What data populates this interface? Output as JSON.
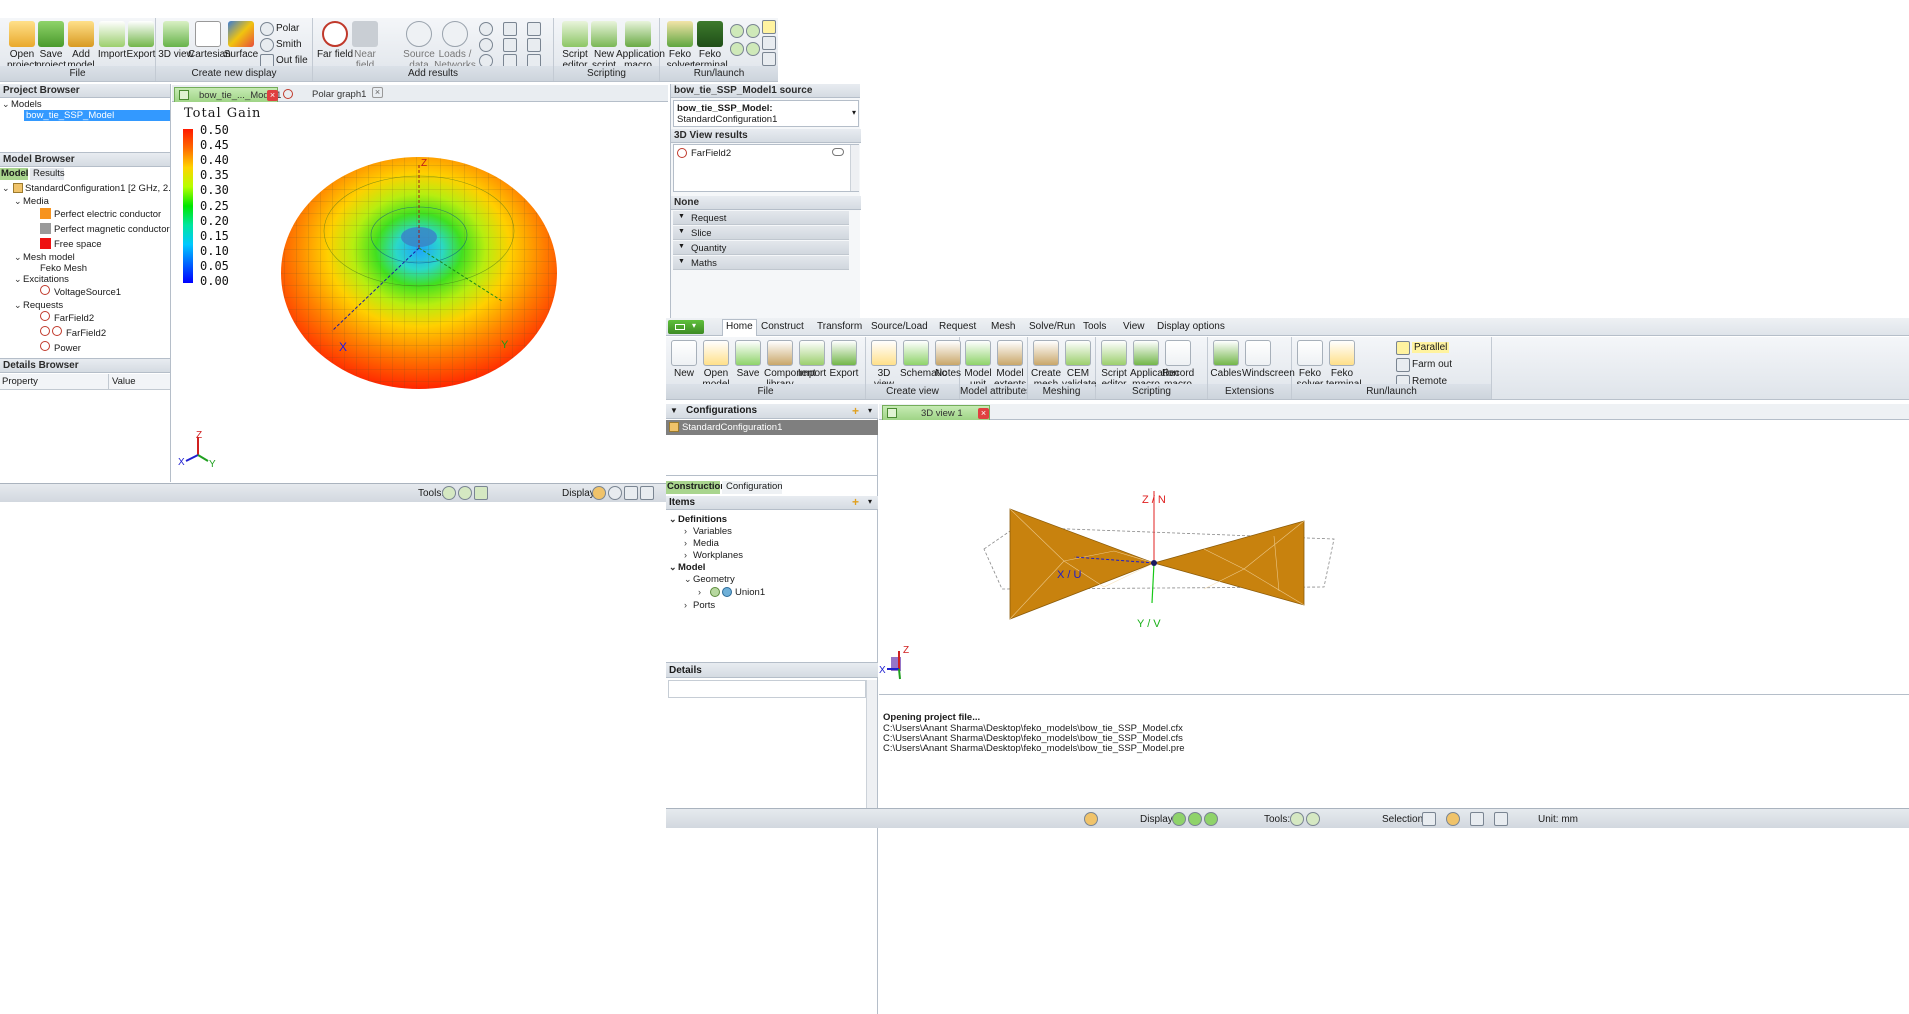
{
  "postfeko": {
    "ribbon": {
      "groups": [
        {
          "label": "File",
          "buttons": [
            "Open project",
            "Save project",
            "Add model",
            "Import",
            "Export"
          ]
        },
        {
          "label": "Create new display",
          "buttons": [
            "3D view",
            "Cartesian",
            "Surface"
          ],
          "small": [
            "Polar",
            "Smith",
            "Out file"
          ]
        },
        {
          "label": "Add results",
          "buttons": [
            "Far field",
            "Near field",
            "Source data",
            "Loads / Networks"
          ]
        },
        {
          "label": "Scripting",
          "buttons": [
            "Script editor",
            "New script",
            "Application macro"
          ]
        },
        {
          "label": "Run/launch",
          "buttons": [
            "Feko solver",
            "Feko terminal"
          ]
        }
      ]
    },
    "project_browser": {
      "title": "Project Browser",
      "models_label": "Models",
      "selected_model": "bow_tie_SSP_Model"
    },
    "model_browser": {
      "title": "Model Browser",
      "tabs": [
        "Model",
        "Results"
      ],
      "config": "StandardConfiguration1 [2 GHz, 2.0101 ...",
      "media_label": "Media",
      "media": [
        {
          "name": "Perfect electric conductor",
          "color": "#f7931e"
        },
        {
          "name": "Perfect magnetic conductor",
          "color": "#9a9a9a"
        },
        {
          "name": "Free space",
          "color": "#ee1111"
        }
      ],
      "mesh_model_label": "Mesh model",
      "mesh_item": "Feko Mesh",
      "excitations_label": "Excitations",
      "excitation_item": "VoltageSource1",
      "requests_label": "Requests",
      "requests": [
        "FarField2",
        "FarField2",
        "Power"
      ]
    },
    "details_browser": {
      "title": "Details Browser",
      "columns": [
        "Property",
        "Value"
      ]
    },
    "doc_tabs": [
      "bow_tie_..._Model1",
      "Polar graph1"
    ],
    "plot": {
      "legend_title": "Total Gain",
      "legend_values": [
        "0.50",
        "0.45",
        "0.40",
        "0.35",
        "0.30",
        "0.25",
        "0.20",
        "0.15",
        "0.10",
        "0.05",
        "0.00"
      ],
      "axis_x": "X",
      "axis_y": "Y",
      "axis_z": "Z"
    },
    "statusbar": {
      "tools_label": "Tools:",
      "display_label": "Display:"
    },
    "source_panel": {
      "title": "bow_tie_SSP_Model1 source",
      "source_name": "bow_tie_SSP_Model:",
      "source_config": "StandardConfiguration1",
      "results_title": "3D View results",
      "result_item": "FarField2",
      "none_title": "None",
      "sections": [
        "Request",
        "Slice",
        "Quantity",
        "Maths"
      ]
    }
  },
  "cadfeko": {
    "menu_tabs": [
      "Home",
      "Construct",
      "Transform",
      "Source/Load",
      "Request",
      "Mesh",
      "Solve/Run",
      "Tools",
      "View",
      "Display options"
    ],
    "ribbon": {
      "groups": [
        {
          "label": "File",
          "buttons": [
            "New",
            "Open model",
            "Save",
            "Component library",
            "Import",
            "Export"
          ]
        },
        {
          "label": "Create view",
          "buttons": [
            "3D view",
            "Schematic",
            "Notes"
          ]
        },
        {
          "label": "Model attributes",
          "buttons": [
            "Model unit",
            "Model extents"
          ]
        },
        {
          "label": "Meshing",
          "buttons": [
            "Create mesh",
            "CEM validate"
          ]
        },
        {
          "label": "Scripting",
          "buttons": [
            "Script editor",
            "Application macro",
            "Record macro"
          ]
        },
        {
          "label": "Extensions",
          "buttons": [
            "Cables",
            "Windscreen"
          ]
        },
        {
          "label": "Run/launch",
          "buttons": [
            "Feko solver",
            "Feko terminal"
          ],
          "small": [
            "Parallel",
            "Farm out",
            "Remote"
          ]
        }
      ]
    },
    "configurations": {
      "title": "Configurations",
      "item": "StandardConfiguration1"
    },
    "tabs": [
      "Construction",
      "Configuration"
    ],
    "items": {
      "title": "Items",
      "definitions_label": "Definitions",
      "definitions": [
        "Variables",
        "Media",
        "Workplanes"
      ],
      "model_label": "Model",
      "geometry_label": "Geometry",
      "union_label": "Union1",
      "ports_label": "Ports"
    },
    "details_title": "Details",
    "view_tab": "3D view 1",
    "view_axes": {
      "z": "Z / N",
      "x": "X / U",
      "y": "Y / V",
      "z_small": "Z",
      "x_small": "X"
    },
    "log": {
      "heading": "Opening project file...",
      "lines": [
        "C:\\Users\\Anant Sharma\\Desktop\\feko_models\\bow_tie_SSP_Model.cfx",
        "C:\\Users\\Anant Sharma\\Desktop\\feko_models\\bow_tie_SSP_Model.cfs",
        "C:\\Users\\Anant Sharma\\Desktop\\feko_models\\bow_tie_SSP_Model.pre"
      ]
    },
    "statusbar": {
      "display_label": "Display:",
      "tools_label": "Tools:",
      "selection_label": "Selection:",
      "unit_label": "Unit: mm"
    }
  }
}
